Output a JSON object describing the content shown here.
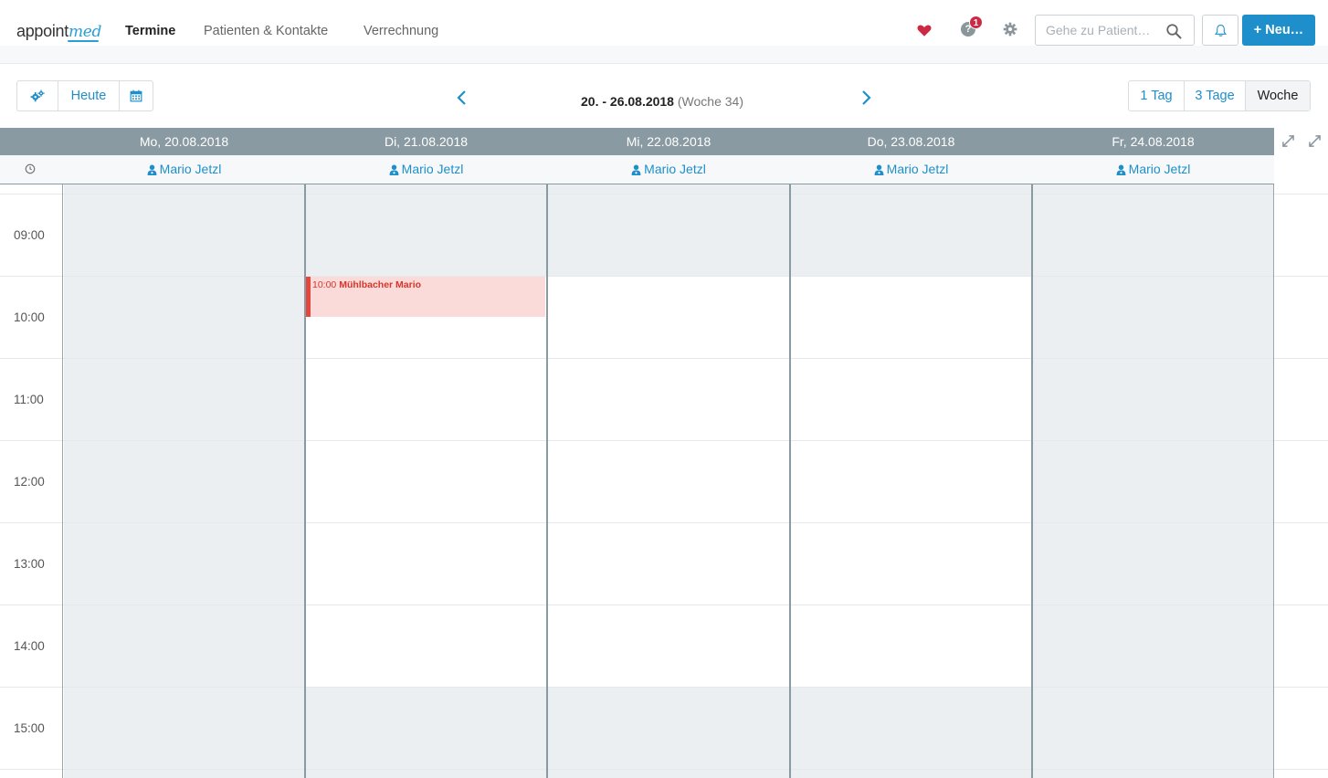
{
  "app": {
    "logo_main": "appoint",
    "logo_accent": "med"
  },
  "nav": {
    "items": [
      {
        "label": "Termine",
        "active": true
      },
      {
        "label": "Patienten & Kontakte",
        "active": false
      },
      {
        "label": "Verrechnung",
        "active": false
      }
    ]
  },
  "header": {
    "help_icon": "?",
    "notification_count": "1",
    "search_placeholder": "Gehe zu Patient…",
    "new_button": "+ Neu…",
    "icons": [
      "heart-icon",
      "help-icon",
      "gear-icon",
      "search-icon",
      "bell-icon"
    ],
    "heart_color": "#cc2944",
    "accent_color": "#1e8fca"
  },
  "toolbar": {
    "today_label": "Heute",
    "range_label": "20. - 26.08.2018",
    "week_label": "(Woche 34)",
    "views": [
      {
        "label": "1 Tag",
        "active": false
      },
      {
        "label": "3 Tage",
        "active": false
      },
      {
        "label": "Woche",
        "active": true
      }
    ]
  },
  "calendar": {
    "days": [
      {
        "label": "Mo, 20.08.2018",
        "resource": "Mario Jetzl"
      },
      {
        "label": "Di, 21.08.2018",
        "resource": "Mario Jetzl"
      },
      {
        "label": "Mi, 22.08.2018",
        "resource": "Mario Jetzl"
      },
      {
        "label": "Do, 23.08.2018",
        "resource": "Mario Jetzl"
      },
      {
        "label": "Fr, 24.08.2018",
        "resource": "Mario Jetzl"
      }
    ],
    "hours": [
      "09:00",
      "10:00",
      "11:00",
      "12:00",
      "13:00",
      "14:00",
      "15:00"
    ],
    "appointment": {
      "time": "10:00",
      "patient": "Mühlbacher Mario",
      "color": "#e3473e"
    }
  }
}
